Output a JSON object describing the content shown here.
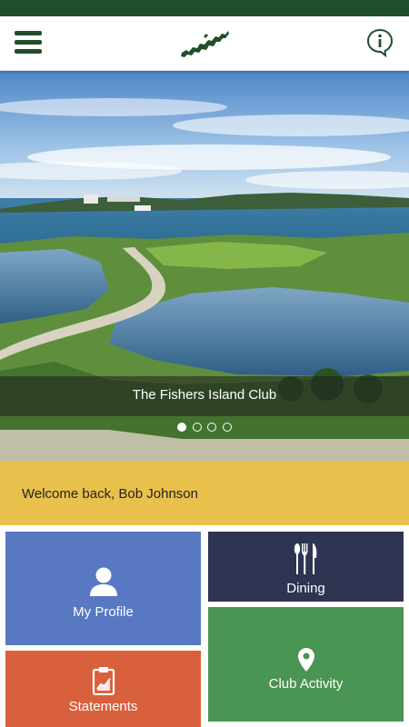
{
  "colors": {
    "brand_green": "#1f4f2a",
    "welcome_bg": "#e8c14c",
    "tile_profile": "#5878c2",
    "tile_dining": "#2e3452",
    "tile_statements": "#d9603d",
    "tile_activity": "#4a9553"
  },
  "header": {
    "menu_icon": "hamburger-menu-icon",
    "logo_icon": "island-logo-icon",
    "info_icon": "info-icon"
  },
  "hero": {
    "caption": "The Fishers Island Club",
    "slide_count": 4,
    "active_slide": 1
  },
  "welcome": {
    "text": "Welcome back, Bob Johnson"
  },
  "tiles": [
    {
      "label": "My Profile",
      "icon": "user-icon"
    },
    {
      "label": "Dining",
      "icon": "fork-knife-icon"
    },
    {
      "label": "Statements",
      "icon": "clipboard-chart-icon"
    },
    {
      "label": "Club Activity",
      "icon": "location-pin-icon"
    }
  ]
}
